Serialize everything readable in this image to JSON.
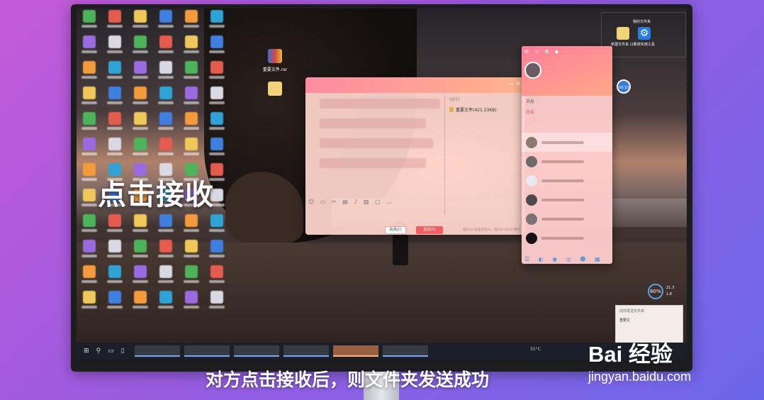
{
  "subtitle": "对方点击接收后，则文件夹发送成功",
  "overlay_caption": "点击接收",
  "watermark": {
    "logo": "Bai 经验",
    "url": "jingyan.baidu.com"
  },
  "desktop": {
    "files": [
      {
        "label": "重要文件.rar",
        "icon": "rar-archive-icon"
      },
      {
        "label": "",
        "icon": "folder-icon"
      }
    ],
    "top_right": {
      "title": "我的文件夹",
      "items": [
        {
          "label": "新建文件夹 (2)",
          "icon": "folder-icon"
        },
        {
          "label": "系统实用工具",
          "icon": "settings-icon"
        }
      ]
    },
    "timer": "00:10",
    "gauge": {
      "value": "60%",
      "up": "21.3",
      "down": "1.8"
    }
  },
  "chat_window": {
    "transfer_header": "(0/1)",
    "transfer_file": "重要文件(421.23KB)",
    "buttons": {
      "close": "关闭(C)",
      "send": "发送(S)"
    },
    "footnote": "按Enter发送消息(I)，按Ctrl+Enter换行"
  },
  "qq_panel": {
    "tabs": [
      "消息",
      "好友"
    ],
    "active_tab": "好友"
  },
  "notification": {
    "title": "向你发送文件夹",
    "item": "重要文"
  },
  "taskbar": {
    "weather": "31°C",
    "colors": {
      "bg": "#1b1f2a",
      "accent": "#79a7f0"
    }
  },
  "colors": {
    "accent": "#f45d62",
    "chat_header": "#ff8aa0"
  }
}
